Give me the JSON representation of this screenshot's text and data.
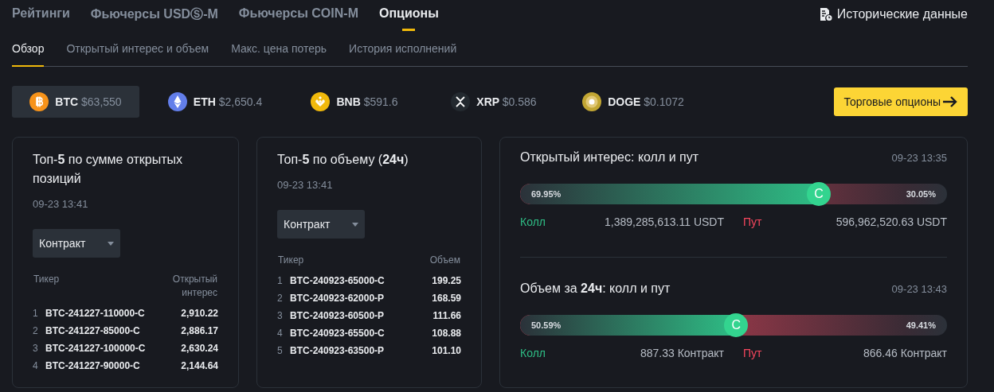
{
  "main_tabs": [
    {
      "label": "Рейтинги",
      "selected": false
    },
    {
      "label": "Фьючерсы USDⓈ-M",
      "selected": false
    },
    {
      "label": "Фьючерсы COIN-M",
      "selected": false
    },
    {
      "label": "Опционы",
      "selected": true
    }
  ],
  "history_link": {
    "label": "Исторические данные"
  },
  "sub_tabs": [
    {
      "label": "Обзор",
      "selected": true
    },
    {
      "label": "Открытый интерес и объем",
      "selected": false
    },
    {
      "label": "Макс. цена потерь",
      "selected": false
    },
    {
      "label": "История исполнений",
      "selected": false
    }
  ],
  "coins": [
    {
      "kind": "btc",
      "color": "#f7931a",
      "symbol": "BTC",
      "price": "$63,550",
      "selected": true
    },
    {
      "kind": "eth",
      "color": "#627eea",
      "symbol": "ETH",
      "price": "$2,650.4",
      "selected": false
    },
    {
      "kind": "bnb",
      "color": "#f0b90b",
      "symbol": "BNB",
      "price": "$591.6",
      "selected": false
    },
    {
      "kind": "xrp",
      "color": "#23292f",
      "symbol": "XRP",
      "price": "$0.586",
      "selected": false
    },
    {
      "kind": "doge",
      "color": "#c2a633",
      "symbol": "DOGE",
      "price": "$0.1072",
      "selected": false
    }
  ],
  "trade_button": {
    "label": "Торговые опционы"
  },
  "top_cards": [
    {
      "title": "Топ-**5** по сумме открытых позиций",
      "time": "09-23 13:41",
      "dropdown": "Контракт",
      "columns": [
        "Тикер",
        "Открытый интерес"
      ],
      "rows": [
        {
          "rank": "1",
          "ticker": "BTC-241227-110000-C",
          "value": "2,910.22"
        },
        {
          "rank": "2",
          "ticker": "BTC-241227-85000-C",
          "value": "2,886.17"
        },
        {
          "rank": "3",
          "ticker": "BTC-241227-100000-C",
          "value": "2,630.24"
        },
        {
          "rank": "4",
          "ticker": "BTC-241227-90000-C",
          "value": "2,144.64"
        }
      ]
    },
    {
      "title": "Топ-**5** по объему (**24ч**)",
      "time": "09-23 13:41",
      "dropdown": "Контракт",
      "columns": [
        "Тикер",
        "Объем"
      ],
      "rows": [
        {
          "rank": "1",
          "ticker": "BTC-240923-65000-C",
          "value": "199.25"
        },
        {
          "rank": "2",
          "ticker": "BTC-240923-62000-P",
          "value": "168.59"
        },
        {
          "rank": "3",
          "ticker": "BTC-240923-60500-P",
          "value": "111.66"
        },
        {
          "rank": "4",
          "ticker": "BTC-240923-65500-C",
          "value": "108.88"
        },
        {
          "rank": "5",
          "ticker": "BTC-240923-63500-P",
          "value": "101.10"
        }
      ]
    }
  ],
  "ratio_sections": [
    {
      "title": "Открытый интерес: колл и пут",
      "time": "09-23 13:35",
      "call_pct": "69.95%",
      "put_pct": "30.05%",
      "level": 0.6995,
      "marker": "C",
      "call_label": "Колл",
      "call_value": "1,389,285,613.11 USDT",
      "put_label": "Пут",
      "put_value": "596,962,520.63 USDT"
    },
    {
      "title": "Объем за **24ч**: колл и пут",
      "time": "09-23 13:43",
      "call_pct": "50.59%",
      "put_pct": "49.41%",
      "level": 0.5059,
      "marker": "C",
      "call_label": "Колл",
      "call_value": "887.33 Контракт",
      "put_label": "Пут",
      "put_value": "866.46 Контракт"
    }
  ]
}
